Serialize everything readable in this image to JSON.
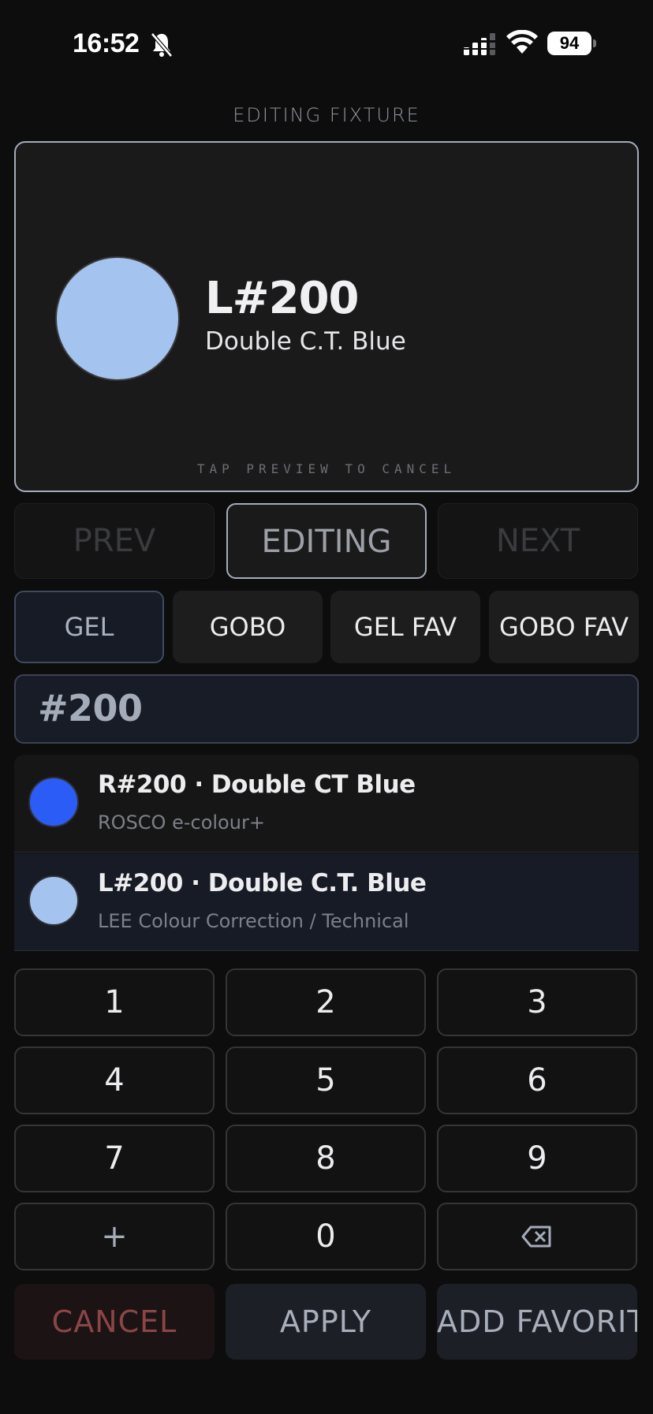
{
  "status_bar": {
    "time": "16:52",
    "battery": "94",
    "icons": [
      "bell-slash-icon",
      "cellular-signal-icon",
      "wifi-icon",
      "battery-icon"
    ]
  },
  "header": {
    "label": "EDITING FIXTURE"
  },
  "preview": {
    "code": "L#200",
    "name": "Double C.T. Blue",
    "swatch_color": "#a4c3ee",
    "hint": "TAP PREVIEW TO CANCEL"
  },
  "nav": {
    "prev": "PREV",
    "editing": "EDITING",
    "next": "NEXT"
  },
  "tabs": [
    {
      "label": "GEL",
      "active": true
    },
    {
      "label": "GOBO",
      "active": false
    },
    {
      "label": "GEL FAV",
      "active": false
    },
    {
      "label": "GOBO FAV",
      "active": false
    }
  ],
  "search": {
    "value": "#200"
  },
  "results": [
    {
      "title": "R#200 · Double CT Blue",
      "subtitle": "ROSCO e-colour+",
      "swatch_color": "#2b5cf5",
      "selected": false
    },
    {
      "title": "L#200 · Double C.T. Blue",
      "subtitle": "LEE Colour Correction / Technical",
      "swatch_color": "#a4c3ee",
      "selected": true
    }
  ],
  "keypad": [
    "1",
    "2",
    "3",
    "4",
    "5",
    "6",
    "7",
    "8",
    "9",
    "+",
    "0",
    "⌫"
  ],
  "actions": {
    "cancel": "CANCEL",
    "apply": "APPLY",
    "add_favorite": "ADD FAVORIT"
  },
  "colors": {
    "accent": "#a4acba",
    "background": "#0d0d0e",
    "cancel_text": "#8a4646"
  }
}
